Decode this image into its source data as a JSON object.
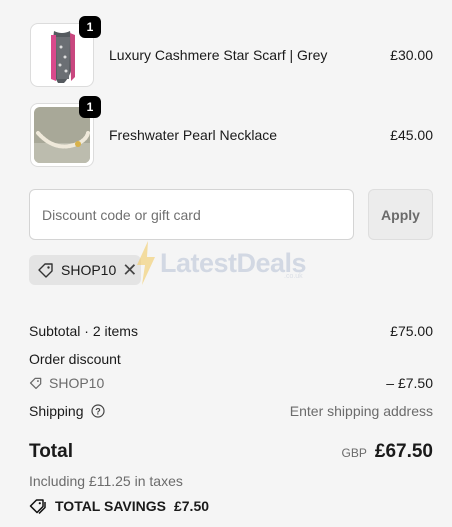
{
  "items": [
    {
      "name": "Luxury Cashmere Star Scarf | Grey",
      "price": "£30.00",
      "quantity": "1",
      "image": "grey-pink-star-scarf"
    },
    {
      "name": "Freshwater Pearl Necklace",
      "price": "£45.00",
      "quantity": "1",
      "image": "pearl-necklace"
    }
  ],
  "discount": {
    "placeholder": "Discount code or gift card",
    "value": "",
    "apply_label": "Apply",
    "applied_code": "SHOP10"
  },
  "watermark": {
    "brand": "LatestDeals",
    "sub": ".co.uk"
  },
  "summary": {
    "subtotal_label": "Subtotal · 2 items",
    "subtotal_value": "£75.00",
    "order_discount_label": "Order discount",
    "discount_code": "SHOP10",
    "discount_value": "– £7.50",
    "shipping_label": "Shipping",
    "shipping_value": "Enter shipping address",
    "total_label": "Total",
    "currency": "GBP",
    "total_value": "£67.50",
    "tax_note": "Including £11.25 in taxes",
    "savings_label": "TOTAL SAVINGS",
    "savings_value": "£7.50"
  },
  "colors": {
    "background": "#f5f5f5",
    "badge": "#000000",
    "muted": "#6b6b6b"
  }
}
